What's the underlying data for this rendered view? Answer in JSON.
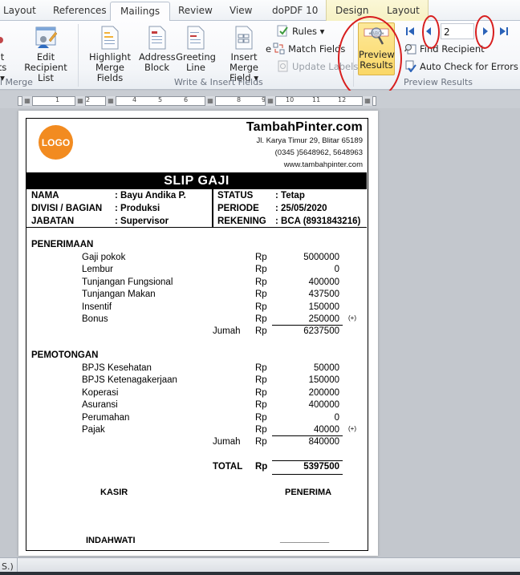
{
  "tabs": [
    {
      "label": "Layout",
      "active": false
    },
    {
      "label": "References",
      "active": false
    },
    {
      "label": "Mailings",
      "active": true
    },
    {
      "label": "Review",
      "active": false
    },
    {
      "label": "View",
      "active": false
    },
    {
      "label": "doPDF 10",
      "active": false
    },
    {
      "label": "Design",
      "active": false,
      "contextual": true
    },
    {
      "label": "Layout",
      "active": false,
      "contextual": true
    }
  ],
  "ribbon": {
    "start_mail_merge": {
      "partial_button_label_line1": "t",
      "partial_button_label_line2": "ts ▾",
      "edit_recipient_list_line1": "Edit",
      "edit_recipient_list_line2": "Recipient List",
      "group_label": "l Merge"
    },
    "write_insert": {
      "highlight_line1": "Highlight",
      "highlight_line2": "Merge Fields",
      "address_line1": "Address",
      "address_line2": "Block",
      "greeting_line1": "Greeting",
      "greeting_line2": "Line",
      "insert_field_line1": "Insert Merge",
      "insert_field_line2": "Field ▾",
      "rules": "Rules ▾",
      "match_fields": "Match Fields",
      "update_labels": "Update Labels",
      "partial_e": "e",
      "group_label": "Write & Insert Fields"
    },
    "preview": {
      "preview_results_line1": "Preview",
      "preview_results_line2": "Results",
      "record_value": "2",
      "find_recipient": "Find Recipient",
      "auto_check": "Auto Check for Errors",
      "group_label": "Preview Results"
    }
  },
  "ruler": {
    "ticks": [
      "1",
      "2",
      "4",
      "5",
      "6",
      "8",
      "9",
      "10",
      "11",
      "12"
    ]
  },
  "slip": {
    "logo": "LOGO",
    "company_name": "TambahPinter.com",
    "address": "Jl. Karya Timur 29, Blitar 65189",
    "phone": "(0345 )5648962,  5648963",
    "website": "www.tambahpinter.com",
    "title": "SLIP GAJI",
    "info_left": [
      {
        "label": "NAMA",
        "value": ": Bayu Andika P."
      },
      {
        "label": "DIVISI / BAGIAN",
        "value": ": Produksi"
      },
      {
        "label": "JABATAN",
        "value": ": Supervisor"
      }
    ],
    "info_right": [
      {
        "label": "STATUS",
        "value": ": Tetap"
      },
      {
        "label": "PERIODE",
        "value": ": 25/05/2020"
      },
      {
        "label": "REKENING",
        "value": ": BCA (8931843216)"
      }
    ],
    "currency": "Rp",
    "plus_mark": "(+)",
    "penerimaan": {
      "title": "PENERIMAAN",
      "items": [
        {
          "label": "Gaji pokok",
          "amount": "5000000"
        },
        {
          "label": "Lembur",
          "amount": "0"
        },
        {
          "label": "Tunjangan Fungsional",
          "amount": "400000"
        },
        {
          "label": "Tunjangan Makan",
          "amount": "437500"
        },
        {
          "label": "Insentif",
          "amount": "150000"
        },
        {
          "label": "Bonus",
          "amount": "250000"
        }
      ],
      "sum_label": "Jumah",
      "sum": "6237500"
    },
    "pemotongan": {
      "title": "PEMOTONGAN",
      "items": [
        {
          "label": "BPJS Kesehatan",
          "amount": "50000"
        },
        {
          "label": "BPJS Ketenagakerjaan",
          "amount": "150000"
        },
        {
          "label": "Koperasi",
          "amount": "200000"
        },
        {
          "label": "Asuransi",
          "amount": "400000"
        },
        {
          "label": "Perumahan",
          "amount": "0"
        },
        {
          "label": "Pajak",
          "amount": "40000"
        }
      ],
      "sum_label": "Jumah",
      "sum": "840000"
    },
    "total_label": "TOTAL",
    "total": "5397500",
    "kasir_label": "KASIR",
    "penerima_label": "PENERIMA",
    "kasir_name": "INDAHWATI",
    "penerima_name": "__________"
  },
  "statusbar": {
    "text": "S.)"
  },
  "colors": {
    "logo": "#f28b20",
    "annotation": "#d81e1e",
    "preview_active": "#fad767"
  }
}
